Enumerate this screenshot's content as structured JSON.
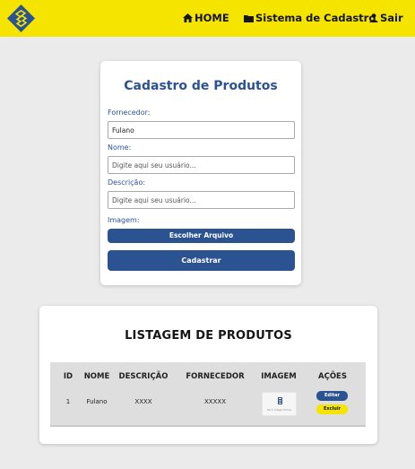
{
  "nav": {
    "home": "HOME",
    "cadastro": "Sistema de Cadastro",
    "sair": "Sair"
  },
  "form": {
    "title": "Cadastro de Produtos",
    "fornecedor_label": "Fornecedor:",
    "fornecedor_value": "Fulano",
    "nome_label": "Nome:",
    "nome_placeholder": "Digite aqui seu usuário...",
    "descricao_label": "Descrição:",
    "descricao_placeholder": "Digite aqui seu usuário...",
    "imagem_label": "Imagem:",
    "file_button": "Escolher Arquivo",
    "submit_button": "Cadastrar"
  },
  "listing": {
    "title": "LISTAGEM DE PRODUTOS",
    "headers": [
      "ID",
      "NOME",
      "DESCRIÇÃO",
      "FORNECEDOR",
      "IMAGEM",
      "AÇÕES"
    ],
    "rows": [
      {
        "id": "1",
        "nome": "Fulano",
        "descricao": "XXXX",
        "fornecedor": "XXXXX",
        "image_text": "Tech Image Home",
        "edit": "Editar",
        "delete": "Excluir"
      }
    ]
  },
  "colors": {
    "brand_yellow": "#f5e300",
    "brand_blue": "#2b5391",
    "background": "#ebebeb"
  },
  "icons": {
    "logo": "banco-do-brasil-logo",
    "home": "home-icon",
    "cadastro": "folder-icon",
    "sair": "user-icon"
  }
}
